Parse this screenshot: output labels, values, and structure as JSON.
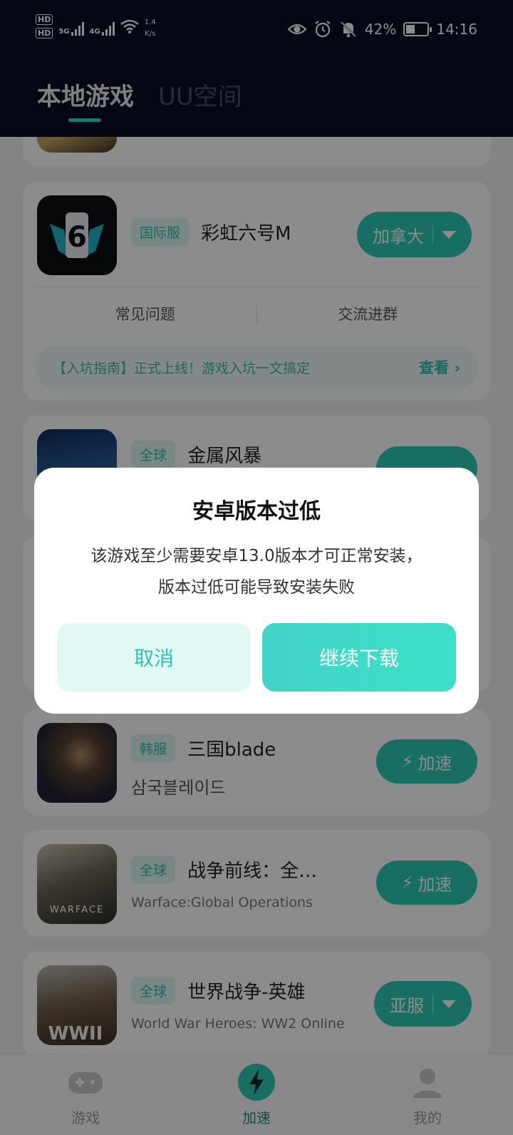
{
  "status": {
    "hd1": "HD",
    "hd2": "HD",
    "sim1": "5G",
    "sim2": "4G",
    "speed_value": "1.4",
    "speed_unit": "K/s",
    "battery": "42%",
    "time": "14:16"
  },
  "header": {
    "tab_local": "本地游戏",
    "tab_uu": "UU空间"
  },
  "games": [
    {
      "tag": "国际服",
      "name": "彩虹六号M",
      "region": "加拿大",
      "links": [
        "常见问题",
        "交流进群"
      ],
      "notice": "【入坑指南】正式上线！游戏入坑一文搞定",
      "notice_more": "查看"
    },
    {
      "tag": "全球",
      "name": "金属风暴"
    },
    {
      "tag": "韩服",
      "name": "三国blade",
      "sub": "삼국블레이드",
      "action": "加速"
    },
    {
      "tag": "全球",
      "name": "战争前线：全…",
      "sub": "Warface:Global Operations",
      "action": "加速"
    },
    {
      "tag": "全球",
      "name": "世界战争-英雄",
      "sub": "World War Heroes: WW2 Online",
      "region": "亚服"
    }
  ],
  "icons": {
    "r6_label": "6",
    "warface_label": "WARFACE",
    "wwii_label": "WWII",
    "bolt": "bolt-icon"
  },
  "dialog": {
    "title": "安卓版本过低",
    "message_line1": "该游戏至少需要安卓13.0版本才可正常安装，",
    "message_line2": "版本过低可能导致安装失败",
    "cancel": "取消",
    "confirm": "继续下载"
  },
  "bottom_nav": {
    "games": "游戏",
    "accelerate": "加速",
    "me": "我的"
  },
  "colors": {
    "accent": "#2cc9b3",
    "header_bg": "#0a0f24"
  }
}
